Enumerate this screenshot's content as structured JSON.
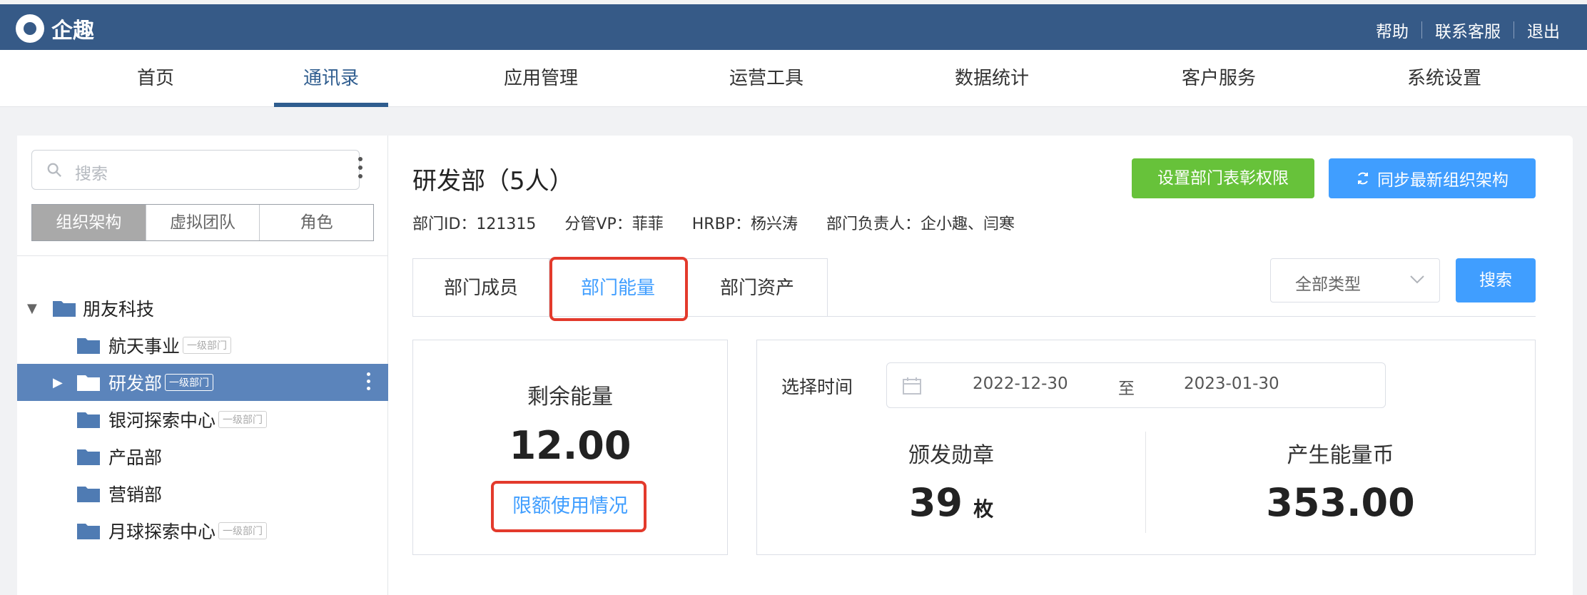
{
  "app": {
    "name": "企趣"
  },
  "toplinks": [
    "帮助",
    "联系客服",
    "退出"
  ],
  "nav": {
    "items": [
      "首页",
      "通讯录",
      "应用管理",
      "运营工具",
      "数据统计",
      "客户服务",
      "系统设置"
    ],
    "active_index": 1
  },
  "sidebar": {
    "search_placeholder": "搜索",
    "segments": [
      "组织架构",
      "虚拟团队",
      "角色"
    ],
    "active_segment": 0,
    "tree": {
      "root": "朋友科技",
      "children": [
        {
          "name": "航天事业",
          "tag": "一级部门"
        },
        {
          "name": "研发部",
          "tag": "一级部门",
          "selected": true
        },
        {
          "name": "银河探索中心",
          "tag": "一级部门"
        },
        {
          "name": "产品部",
          "tag": ""
        },
        {
          "name": "营销部",
          "tag": ""
        },
        {
          "name": "月球探索中心",
          "tag": "一级部门"
        }
      ]
    }
  },
  "dept": {
    "title": "研发部（5人）",
    "meta": {
      "id": "部门ID：121315",
      "vp": "分管VP：菲菲",
      "hrbp": "HRBP：杨兴涛",
      "owner": "部门负责人：企小趣、闫寒"
    }
  },
  "actions": {
    "set_permission": "设置部门表彰权限",
    "sync": "同步最新组织架构"
  },
  "tabs": [
    "部门成员",
    "部门能量",
    "部门资产"
  ],
  "active_tab": 1,
  "filter": {
    "type_select": "全部类型",
    "search_button": "搜索"
  },
  "energy": {
    "remaining_label": "剩余能量",
    "remaining_value": "12.00",
    "quota_link": "限额使用情况"
  },
  "date_range": {
    "label": "选择时间",
    "start": "2022-12-30",
    "separator": "至",
    "end": "2023-01-30"
  },
  "stats": {
    "medals_label": "颁发勋章",
    "medals_value": "39",
    "medals_unit": "枚",
    "coins_label": "产生能量币",
    "coins_value": "353.00"
  },
  "colors": {
    "topbar": "#365a87",
    "accent": "#409eff",
    "green": "#67c23a",
    "highlight": "#e33a2c",
    "selected_row": "#5b84bb"
  }
}
